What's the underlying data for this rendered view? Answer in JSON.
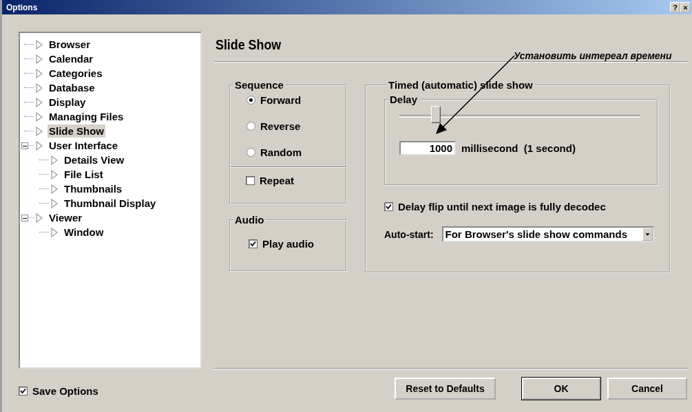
{
  "window": {
    "title": "Options",
    "help": "?",
    "close": "×"
  },
  "tree": [
    {
      "label": "Browser",
      "selected": false
    },
    {
      "label": "Calendar",
      "selected": false
    },
    {
      "label": "Categories",
      "selected": false
    },
    {
      "label": "Database",
      "selected": false
    },
    {
      "label": "Display",
      "selected": false
    },
    {
      "label": "Managing Files",
      "selected": false
    },
    {
      "label": "Slide Show",
      "selected": true
    },
    {
      "label": "User Interface",
      "selected": false,
      "expanded": true,
      "children": [
        {
          "label": "Details View",
          "selected": false
        },
        {
          "label": "File List",
          "selected": false
        },
        {
          "label": "Thumbnails",
          "selected": false
        },
        {
          "label": "Thumbnail Display",
          "selected": false
        }
      ]
    },
    {
      "label": "Viewer",
      "selected": false,
      "expanded": true,
      "children": [
        {
          "label": "Window",
          "selected": false
        }
      ]
    }
  ],
  "save_options": {
    "label": "Save Options",
    "checked": true
  },
  "page_title": "Slide Show",
  "annotation": "Установить интереал времени",
  "sequence": {
    "title": "Sequence",
    "options": [
      {
        "label": "Forward",
        "selected": true
      },
      {
        "label": "Reverse",
        "selected": false
      },
      {
        "label": "Random",
        "selected": false
      }
    ],
    "repeat": {
      "label": "Repeat",
      "checked": false
    }
  },
  "audio": {
    "title": "Audio",
    "play_audio": {
      "label": "Play audio",
      "checked": true
    }
  },
  "timed": {
    "title": "Timed (automatic) slide show",
    "delay": {
      "title": "Delay",
      "level": 0.13,
      "value": "1000",
      "unit": "millisecond  (1 second)"
    },
    "delay_flip": {
      "label": "Delay flip until next image is fully decodec",
      "checked": true
    },
    "auto_start": {
      "label": "Auto-start:",
      "value": "For Browser's slide show commands"
    }
  },
  "buttons": [
    {
      "label": "Reset to Defaults",
      "default": false
    },
    {
      "label": "OK",
      "default": true
    },
    {
      "label": "Cancel",
      "default": false
    }
  ]
}
